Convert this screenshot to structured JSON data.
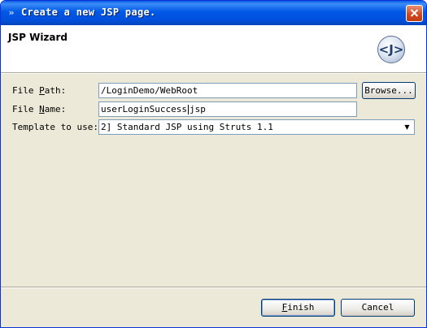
{
  "window": {
    "title": "Create a new JSP page."
  },
  "banner": {
    "title": "JSP Wizard",
    "logo_text": "<J>"
  },
  "form": {
    "file_path": {
      "label_pre": "File ",
      "label_key": "P",
      "label_post": "ath:",
      "value": "/LoginDemo/WebRoot"
    },
    "file_name": {
      "label_pre": "File ",
      "label_key": "N",
      "label_post": "ame:",
      "value_before_caret": "userLoginSuccess",
      "value_after_caret": "jsp"
    },
    "template": {
      "label": "Template to use:",
      "selected": "2] Standard JSP using Struts 1.1"
    },
    "browse_label": "Browse..."
  },
  "footer": {
    "finish_key": "F",
    "finish_rest": "inish",
    "cancel_label": "Cancel"
  },
  "icons": {
    "title_icon": "arrow-icon",
    "close": "close-icon",
    "logo": "jsp-logo-icon",
    "dropdown": "chevron-down-icon"
  }
}
